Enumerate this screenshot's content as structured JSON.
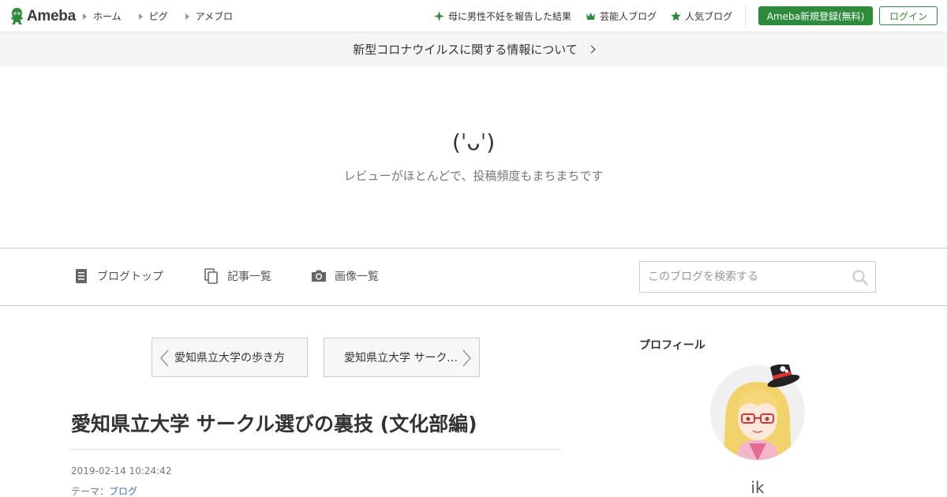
{
  "header": {
    "logo_text": "Ameba",
    "nav_left": [
      {
        "label": "ホーム"
      },
      {
        "label": "ピグ"
      },
      {
        "label": "アメブロ"
      }
    ],
    "nav_right": [
      {
        "label": "母に男性不妊を報告した結果",
        "icon": "sparkle-icon"
      },
      {
        "label": "芸能人ブログ",
        "icon": "crown-icon"
      },
      {
        "label": "人気ブログ",
        "icon": "star-icon"
      }
    ],
    "register_label": "Ameba新規登録(無料)",
    "login_label": "ログイン",
    "accent_color": "#2d8c3c"
  },
  "notice": {
    "text": "新型コロナウイルスに関する情報について"
  },
  "blog": {
    "title": "(ˈᴗˈ)",
    "description": "レビューがほとんどで、投稿頻度もまちまちです"
  },
  "blog_nav": {
    "items": [
      {
        "label": "ブログトップ",
        "icon": "document-icon"
      },
      {
        "label": "記事一覧",
        "icon": "copy-icon"
      },
      {
        "label": "画像一覧",
        "icon": "camera-icon"
      }
    ],
    "search_placeholder": "このブログを検索する"
  },
  "article": {
    "prev_label": "愛知県立大学の歩き方",
    "next_label": "愛知県立大学 サークル選びの裏技 (文化部編)",
    "title": "愛知県立大学 サークル選びの裏技 (文化部編)",
    "date": "2019-02-14 10:24:42",
    "theme_prefix": "テーマ：",
    "theme": "ブログ"
  },
  "sidebar": {
    "heading": "プロフィール",
    "name": "ik"
  }
}
